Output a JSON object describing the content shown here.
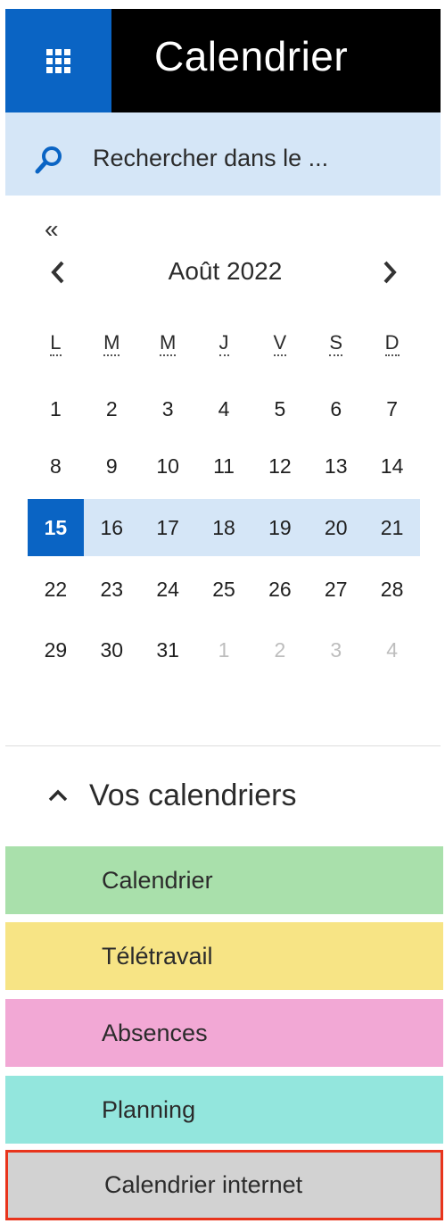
{
  "header": {
    "title": "Calendrier"
  },
  "search": {
    "placeholder": "Rechercher dans le   ..."
  },
  "mini_calendar": {
    "collapse_glyph": "«",
    "month_label": "Août 2022",
    "weekdays": [
      "L",
      "M",
      "M",
      "J",
      "V",
      "S",
      "D"
    ],
    "weeks": [
      [
        "1",
        "2",
        "3",
        "4",
        "5",
        "6",
        "7"
      ],
      [
        "8",
        "9",
        "10",
        "11",
        "12",
        "13",
        "14"
      ],
      [
        "15",
        "16",
        "17",
        "18",
        "19",
        "20",
        "21"
      ],
      [
        "22",
        "23",
        "24",
        "25",
        "26",
        "27",
        "28"
      ],
      [
        "29",
        "30",
        "31",
        "1",
        "2",
        "3",
        "4"
      ]
    ]
  },
  "your_calendars": {
    "title": "Vos calendriers",
    "items": [
      {
        "label": "Calendrier",
        "color": "#a9e0ab"
      },
      {
        "label": "Télétravail",
        "color": "#f7e485"
      },
      {
        "label": "Absences",
        "color": "#f2a8d5"
      },
      {
        "label": "Planning",
        "color": "#93e6dd"
      },
      {
        "label": "Calendrier internet",
        "color": "#d2d2d2"
      }
    ]
  },
  "colors": {
    "accent": "#0a64c4",
    "header_bg": "#000000",
    "search_bg": "#d5e6f7",
    "highlight_border": "#e8341c"
  }
}
